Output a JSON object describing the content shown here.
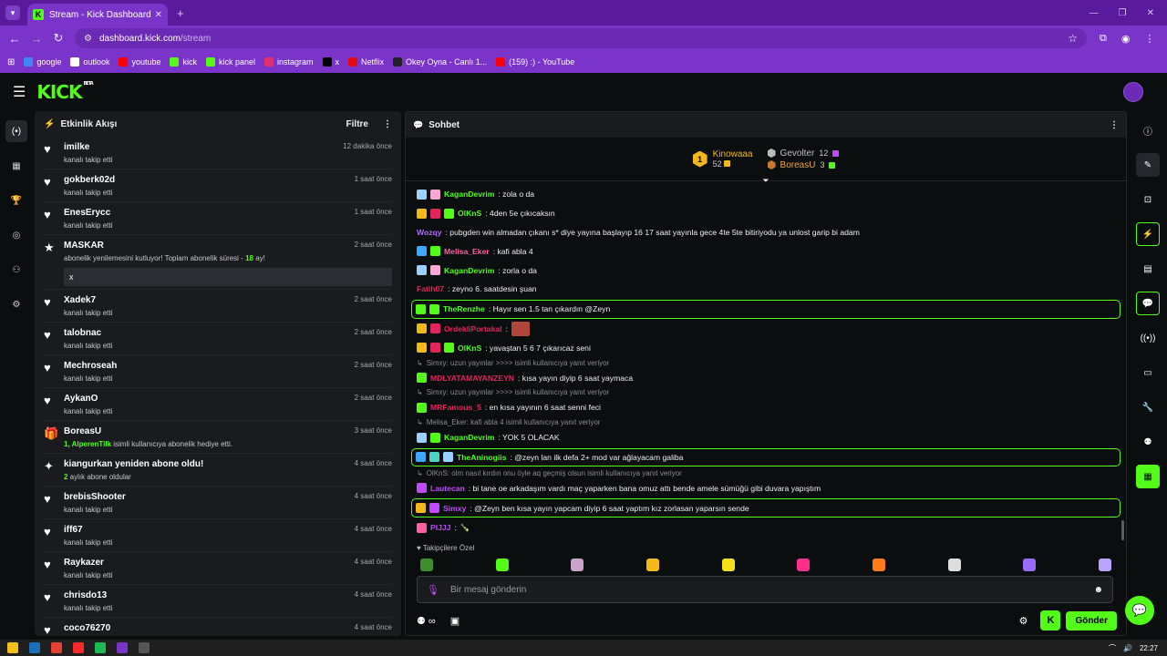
{
  "browser": {
    "tab_title": "Stream - Kick Dashboard",
    "url_site": "dashboard.kick.com",
    "url_path": "/stream",
    "bookmarks": [
      {
        "label": "google",
        "color": "#4285f4"
      },
      {
        "label": "outlook",
        "color": "#ffffff"
      },
      {
        "label": "youtube",
        "color": "#ff0000"
      },
      {
        "label": "kick",
        "color": "#53fc18"
      },
      {
        "label": "kick panel",
        "color": "#53fc18"
      },
      {
        "label": "instagram",
        "color": "#e1306c"
      },
      {
        "label": "x",
        "color": "#000000"
      },
      {
        "label": "Netflix",
        "color": "#e50914"
      },
      {
        "label": "Okey Oyna - Canlı 1...",
        "color": "#222222"
      },
      {
        "label": "(159) :) - YouTube",
        "color": "#ff0000"
      }
    ]
  },
  "activity": {
    "title": "Etkinlik Akışı",
    "filter_label": "Filtre",
    "items": [
      {
        "icon": "heart-icon",
        "name": "imilke",
        "sub": "kanalı takip etti",
        "time": "12 dakika önce"
      },
      {
        "icon": "heart-icon",
        "name": "gokberk02d",
        "sub": "kanalı takip etti",
        "time": "1 saat önce"
      },
      {
        "icon": "heart-icon",
        "name": "EnesErycc",
        "sub": "kanalı takip etti",
        "time": "1 saat önce"
      },
      {
        "icon": "star-icon",
        "name": "MASKAR",
        "sub_pre": "abonelik yenilemesini kutluyor! Toplam abonelik süresi - ",
        "sub_num": "18",
        "sub_post": " ay!",
        "message": "x",
        "time": "2 saat önce"
      },
      {
        "icon": "heart-icon",
        "name": "Xadek7",
        "sub": "kanalı takip etti",
        "time": "2 saat önce"
      },
      {
        "icon": "heart-icon",
        "name": "talobnac",
        "sub": "kanalı takip etti",
        "time": "2 saat önce"
      },
      {
        "icon": "heart-icon",
        "name": "Mechroseah",
        "sub": "kanalı takip etti",
        "time": "2 saat önce"
      },
      {
        "icon": "heart-icon",
        "name": "AykanO",
        "sub": "kanalı takip etti",
        "time": "2 saat önce"
      },
      {
        "icon": "gift-icon",
        "name": "BoreasU",
        "sub_num": "1, AlperenTilk",
        "sub_post": " isimli kullanıcıya abonelik hediye etti.",
        "time": "3 saat önce"
      },
      {
        "icon": "sparkle-icon",
        "name": "kiangurkan yeniden abone oldu!",
        "sub_num": "2",
        "sub_post": " aylık abone oldular",
        "time": "4 saat önce"
      },
      {
        "icon": "heart-icon",
        "name": "brebisShooter",
        "sub": "kanalı takip etti",
        "time": "4 saat önce"
      },
      {
        "icon": "heart-icon",
        "name": "iff67",
        "sub": "kanalı takip etti",
        "time": "4 saat önce"
      },
      {
        "icon": "heart-icon",
        "name": "Raykazer",
        "sub": "kanalı takip etti",
        "time": "4 saat önce"
      },
      {
        "icon": "heart-icon",
        "name": "chrisdo13",
        "sub": "kanalı takip etti",
        "time": "4 saat önce"
      },
      {
        "icon": "heart-icon",
        "name": "coco76270",
        "sub": "",
        "time": "4 saat önce"
      }
    ]
  },
  "chat": {
    "title": "Sohbet",
    "leaderboard": {
      "first": {
        "rank": "1",
        "name": "Kinowaaa",
        "count": "52"
      },
      "second": {
        "name": "Gevolter",
        "count": "12"
      },
      "third": {
        "name": "BoreasU",
        "count": "3"
      }
    },
    "messages": [
      {
        "type": "msg",
        "badges": [
          "#9ad1ff",
          "#f7a8d0"
        ],
        "user": "KaganDevrim",
        "ucolor": "#53fc18",
        "text": ": zola o da"
      },
      {
        "type": "msg",
        "badges": [
          "#f3b81a",
          "#e0245e",
          "#53fc18"
        ],
        "user": "OlKnS",
        "ucolor": "#53fc18",
        "text": ": 4den 5e çıkıcaksın"
      },
      {
        "type": "msg",
        "badges": [],
        "user": "Wozqy",
        "ucolor": "#b26bff",
        "text": ": pubgden win almadan çıkanı s* diye yayına başlayıp 16 17 saat yayınla gece 4te 5te bitiriyodu ya unlost garip bi adam"
      },
      {
        "type": "msg",
        "badges": [
          "#3fa7ff",
          "#53fc18"
        ],
        "user": "Melisa_Eker",
        "ucolor": "#ff5fa2",
        "text": ": kafi abla 4"
      },
      {
        "type": "msg",
        "badges": [
          "#9ad1ff",
          "#f7a8d0"
        ],
        "user": "KaganDevrim",
        "ucolor": "#53fc18",
        "text": ": zorla o da"
      },
      {
        "type": "msg",
        "badges": [],
        "user": "Fatih07",
        "ucolor": "#e0245e",
        "text": ": zeyno 6. saatdesin şuan"
      },
      {
        "type": "hl",
        "badges": [
          "#53fc18",
          "#53fc18"
        ],
        "user": "TheRenzhe",
        "ucolor": "#53fc18",
        "text": ": Hayır sen 1.5 tan çıkardın @Zeyn"
      },
      {
        "type": "msg",
        "badges": [
          "#f3b81a",
          "#e0245e"
        ],
        "user": "OrdekliPortakal",
        "ucolor": "#e0245e",
        "text": ":",
        "emote": true
      },
      {
        "type": "msg",
        "badges": [
          "#f3b81a",
          "#e0245e",
          "#53fc18"
        ],
        "user": "OlKnS",
        "ucolor": "#53fc18",
        "text": ": yavaştan 5 6 7 çıkarıcaz seni"
      },
      {
        "type": "reply",
        "text": "Simxy: uzun yayınlar >>>> isimli kullanıcıya yanıt veriyor"
      },
      {
        "type": "msg",
        "badges": [
          "#53fc18"
        ],
        "user": "MDLYATAMAYANZEYN",
        "ucolor": "#e0245e",
        "text": ": kısa yayın diyip 6 saat yaymaca"
      },
      {
        "type": "reply",
        "text": "Simxy: uzun yayınlar >>>> isimli kullanıcıya yanıt veriyor"
      },
      {
        "type": "msg",
        "badges": [
          "#53fc18"
        ],
        "user": "MRFamous_5",
        "ucolor": "#e0245e",
        "text": ": en kısa yayının 6 saat senni feci"
      },
      {
        "type": "reply",
        "text": "Melisa_Eker: kafi abla 4 isimli kullanıcıya yanıt veriyor"
      },
      {
        "type": "msg",
        "badges": [
          "#9ad1ff",
          "#53fc18"
        ],
        "user": "KaganDevrim",
        "ucolor": "#53fc18",
        "text": ": YOK 5 OLACAK"
      },
      {
        "type": "hl",
        "badges": [
          "#3fa7ff",
          "#4fd1c5",
          "#9ad1ff"
        ],
        "user": "TheAninogiis",
        "ucolor": "#53fc18",
        "text": ": @zeyn lan ilk defa 2+ mod var ağlayacam galiba"
      },
      {
        "type": "reply",
        "text": "OlKnS: olm nasıl kırdın onu öyle aq geçmiş olsun isimli kullanıcıya yanıt veriyor"
      },
      {
        "type": "msg",
        "badges": [
          "#c04aff"
        ],
        "user": "Lautecan",
        "ucolor": "#c04aff",
        "text": ": bi tane oe arkadaşım vardı maç yaparken bana omuz attı bende amele sümüğü gibi duvara yapıştım"
      },
      {
        "type": "hl",
        "badges": [
          "#f3b81a",
          "#c04aff"
        ],
        "user": "Simxy",
        "ucolor": "#c04aff",
        "text": ": @Zeyn ben kısa yayın yapcam diyip 6 saat yaptım kız zorlasan yaparsın sende"
      },
      {
        "type": "msg",
        "badges": [
          "#ff5fa2"
        ],
        "user": "PIJJJ",
        "ucolor": "#c04aff",
        "text": ":",
        "bottle": "🍾"
      }
    ],
    "followers_label": "Takipçilere Özel",
    "input_placeholder": "Bir mesaj gönderin",
    "send_label": "Gönder",
    "emote_colors": [
      "#3f8d2f",
      "#53fc18",
      "#c9a3c9",
      "#f3b81a",
      "#f3e01a",
      "#ff2e88",
      "#ff7b1a",
      "#dddddd",
      "#9a6bff",
      "#b8a3ff"
    ]
  },
  "taskbar": {
    "time": "22:27"
  }
}
